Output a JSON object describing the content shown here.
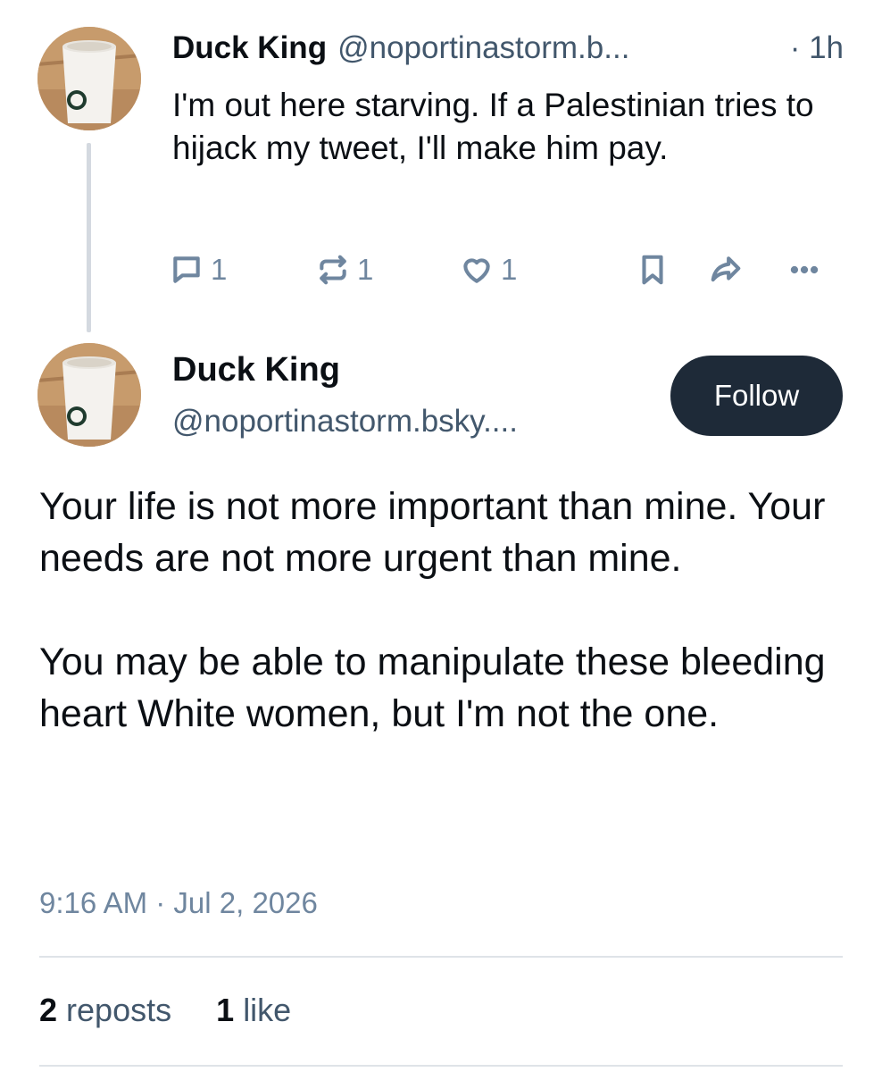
{
  "parent_post": {
    "display_name": "Duck King",
    "handle": "@noportinastorm.b...",
    "time": "· 1h",
    "text": "I'm out here starving. If a Palestinian tries to hijack my tweet, I'll make him pay.",
    "reply_count": "1",
    "repost_count": "1",
    "like_count": "1",
    "icons": [
      "reply-icon",
      "repost-icon",
      "like-icon",
      "bookmark-icon",
      "share-icon",
      "more-icon"
    ]
  },
  "main_post": {
    "display_name": "Duck King",
    "handle": "@noportinastorm.bsky....",
    "follow_label": "Follow",
    "text": "Your life is not more important than mine. Your needs are not more urgent than mine.\n\nYou may be able to manipulate these bleeding heart White women, but I'm not the one.",
    "timestamp": "9:16 AM · Jul 2, 2026",
    "reposts_count": "2",
    "reposts_label": "reposts",
    "likes_count": "1",
    "likes_label": "like"
  },
  "colors": {
    "follow_button_bg": "#1e2a38",
    "muted_text": "#42576c",
    "icon_color": "#6f869f",
    "thread_line": "#d4d9e0"
  }
}
